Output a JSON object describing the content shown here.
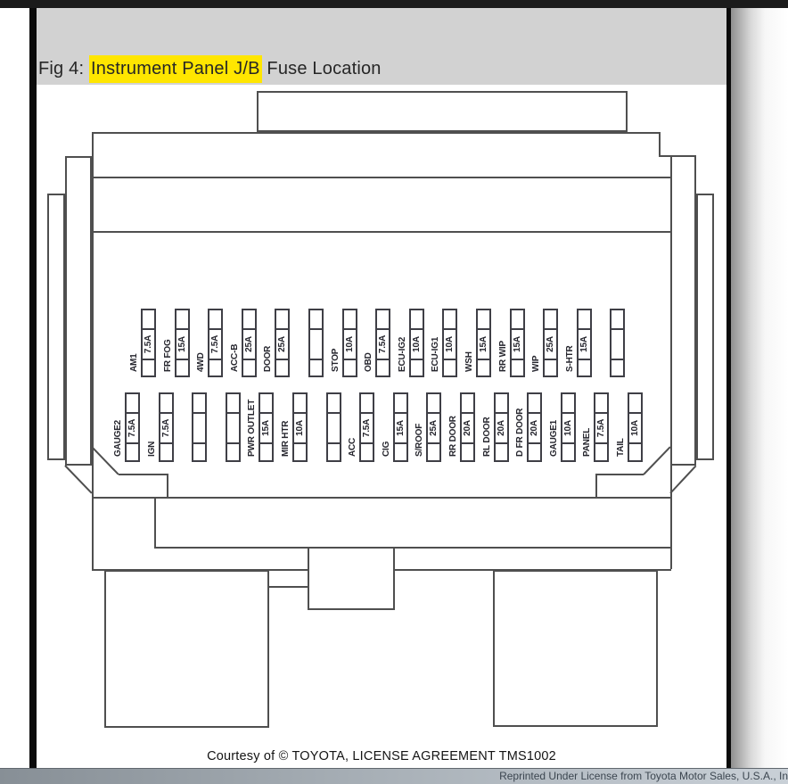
{
  "header": {
    "prefix": "Fig 4: ",
    "highlight": "Instrument Panel J/B",
    "suffix": " Fuse Location"
  },
  "footer": {
    "courtesy": "Courtesy of © TOYOTA, LICENSE AGREEMENT TMS1002",
    "license": "Reprinted Under License from Toyota Motor Sales, U.S.A., In"
  },
  "colors": {
    "highlight_yellow": "#ffe600",
    "title_band_gray": "#d2d2d2",
    "outline_gray": "#4f4f4f",
    "label_ink": "#26262e",
    "license_bar_left": "#878f96",
    "license_bar_right": "#c9d0d7"
  },
  "diagram": {
    "title": "Instrument Panel J/B Fuse Location",
    "top_row": [
      {
        "name": "AM1",
        "amp": "7.5A"
      },
      {
        "name": "FR FOG",
        "amp": "15A"
      },
      {
        "name": "4WD",
        "amp": "7.5A"
      },
      {
        "name": "ACC-B",
        "amp": "25A"
      },
      {
        "name": "DOOR",
        "amp": "25A"
      },
      {
        "name": "",
        "amp": ""
      },
      {
        "name": "STOP",
        "amp": "10A"
      },
      {
        "name": "OBD",
        "amp": "7.5A"
      },
      {
        "name": "ECU-IG2",
        "amp": "10A"
      },
      {
        "name": "ECU-IG1",
        "amp": "10A"
      },
      {
        "name": "WSH",
        "amp": "15A"
      },
      {
        "name": "RR WIP",
        "amp": "15A"
      },
      {
        "name": "WIP",
        "amp": "25A"
      },
      {
        "name": "S-HTR",
        "amp": "15A"
      },
      {
        "name": "",
        "amp": ""
      }
    ],
    "bottom_row": [
      {
        "name": "GAUGE2",
        "amp": "7.5A"
      },
      {
        "name": "IGN",
        "amp": "7.5A"
      },
      {
        "name": "",
        "amp": ""
      },
      {
        "name": "",
        "amp": ""
      },
      {
        "name": "PWR OUTLET",
        "amp": "15A"
      },
      {
        "name": "MIR HTR",
        "amp": "10A"
      },
      {
        "name": "",
        "amp": ""
      },
      {
        "name": "ACC",
        "amp": "7.5A"
      },
      {
        "name": "CIG",
        "amp": "15A"
      },
      {
        "name": "S/ROOF",
        "amp": "25A"
      },
      {
        "name": "RR DOOR",
        "amp": "20A"
      },
      {
        "name": "RL DOOR",
        "amp": "20A"
      },
      {
        "name": "D FR DOOR",
        "amp": "20A"
      },
      {
        "name": "GAUGE1",
        "amp": "10A"
      },
      {
        "name": "PANEL",
        "amp": "7.5A"
      },
      {
        "name": "TAIL",
        "amp": "10A"
      }
    ]
  }
}
